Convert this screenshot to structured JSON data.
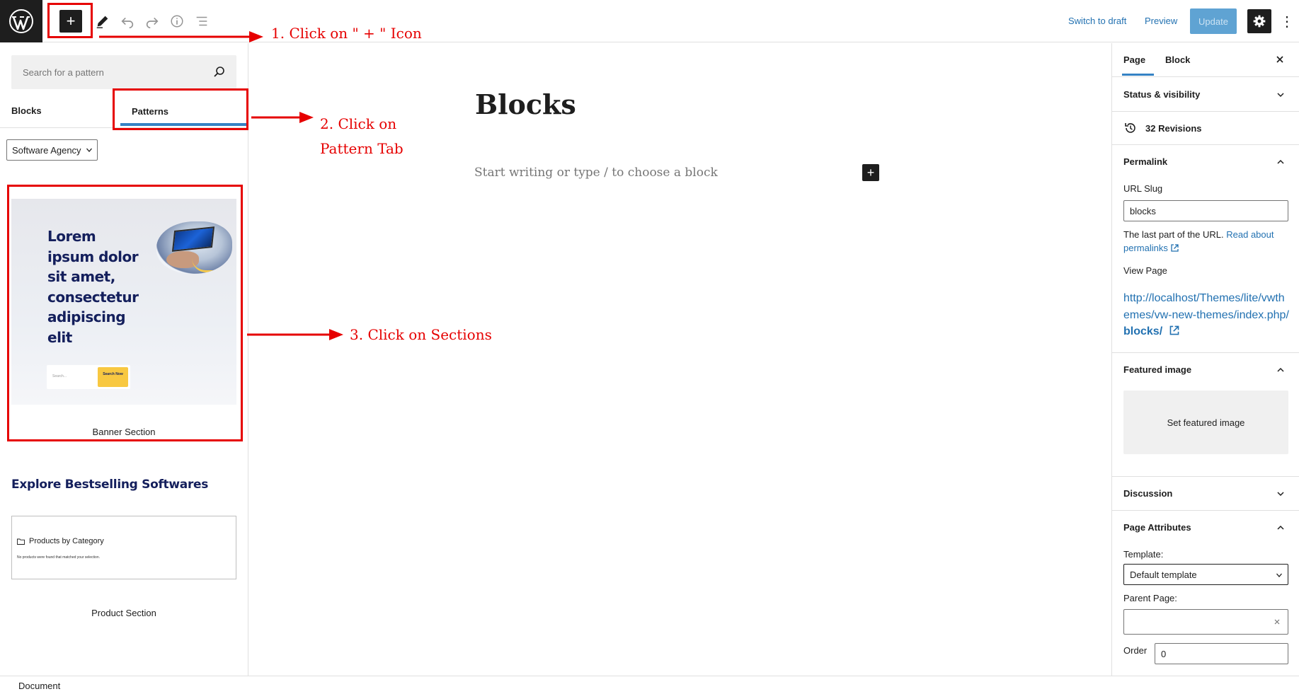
{
  "topbar": {
    "logo_icon": "wordpress-logo-icon",
    "add_icon": "+",
    "switch_to_draft": "Switch to draft",
    "preview": "Preview",
    "update": "Update"
  },
  "inserter": {
    "search_placeholder": "Search for a pattern",
    "tabs": [
      "Blocks",
      "Patterns"
    ],
    "category": "Software Agency",
    "banner_pattern": {
      "title": "Lorem ipsum dolor sit amet, consectetur adipiscing elit",
      "search_placeholder": "Search...",
      "search_button": "Search Now",
      "label": "Banner Section"
    },
    "explore_title": "Explore Bestselling Softwares",
    "product_pattern": {
      "title": "Products by Category",
      "note": "No products were found that matched your selection.",
      "label": "Product Section"
    }
  },
  "editor": {
    "title": "Blocks",
    "appender_placeholder": "Start writing or type / to choose a block"
  },
  "sidebar": {
    "tabs": [
      "Page",
      "Block"
    ],
    "status_visibility": "Status & visibility",
    "revisions": "32 Revisions",
    "permalink": {
      "heading": "Permalink",
      "url_slug_label": "URL Slug",
      "url_slug_value": "blocks",
      "help_text": "The last part of the URL.",
      "help_link": "Read about permalinks",
      "view_page_label": "View Page",
      "view_page_url_prefix": "http://localhost/Themes/lite/vwthemes/vw-new-themes/index.php/",
      "view_page_url_slug": "blocks/"
    },
    "featured_image": {
      "heading": "Featured image",
      "button": "Set featured image"
    },
    "discussion": "Discussion",
    "page_attributes": {
      "heading": "Page Attributes",
      "template_label": "Template:",
      "template_value": "Default template",
      "parent_label": "Parent Page:",
      "parent_value": "",
      "order_label": "Order",
      "order_value": "0"
    }
  },
  "statusbar": {
    "breadcrumb": "Document"
  },
  "annotations": {
    "step1": "1. Click on \" + \" Icon",
    "step2_line1": "2. Click on",
    "step2_line2": "Pattern Tab",
    "step3": "3. Click on Sections",
    "color": "#e60000"
  },
  "colors": {
    "accent": "#3582c4",
    "link": "#2271b1",
    "dark": "#1e1e1e",
    "update_bg": "#5fa3d3",
    "pattern_heading": "#141f5c",
    "pattern_button": "#f8c841"
  }
}
